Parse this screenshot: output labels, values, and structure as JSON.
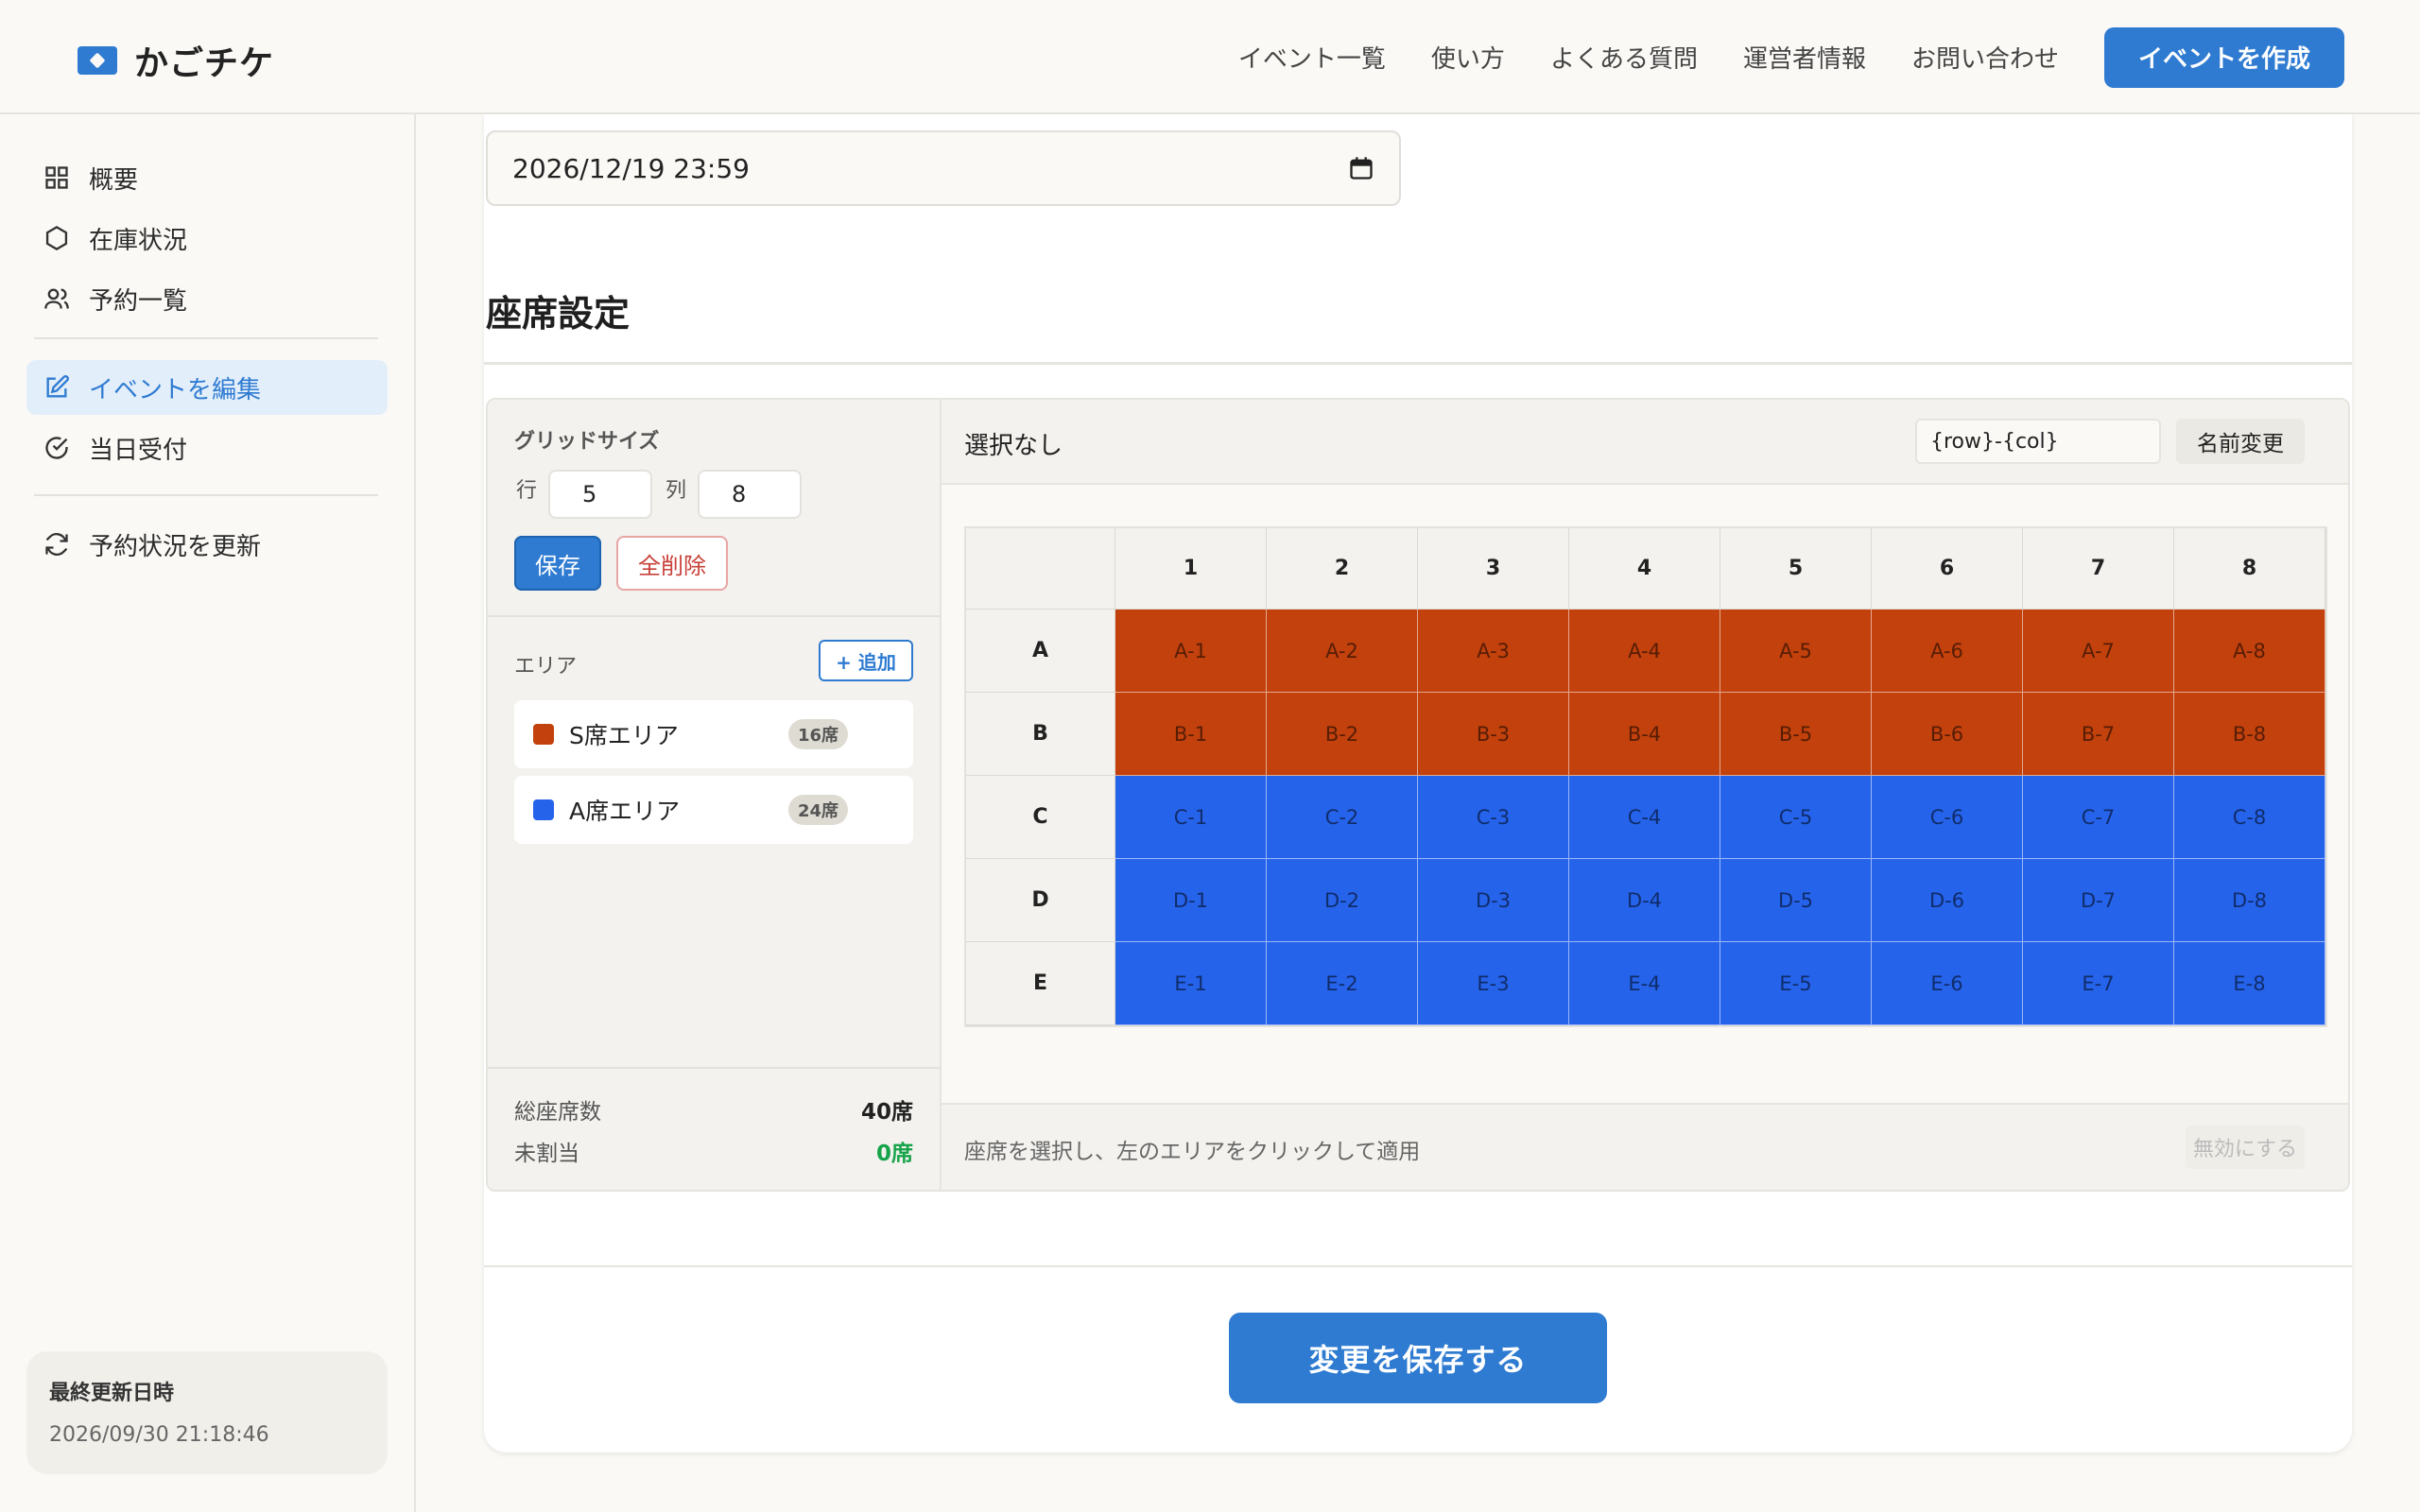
{
  "header": {
    "logo_text": "かごチケ",
    "nav": [
      "イベント一覧",
      "使い方",
      "よくある質問",
      "運営者情報",
      "お問い合わせ"
    ],
    "cta": "イベントを作成",
    "brand_color": "#2e7bd1"
  },
  "sidebar": {
    "items": [
      {
        "label": "概要",
        "icon": "grid-icon"
      },
      {
        "label": "在庫状況",
        "icon": "hexagon-icon"
      },
      {
        "label": "予約一覧",
        "icon": "users-icon"
      },
      {
        "label": "イベントを編集",
        "icon": "edit-icon",
        "active": true
      },
      {
        "label": "当日受付",
        "icon": "check-circle-icon"
      },
      {
        "label": "予約状況を更新",
        "icon": "refresh-icon"
      }
    ],
    "update_title": "最終更新日時",
    "update_time": "2026/09/30 21:18:46"
  },
  "form": {
    "deadline_value": "2026/12/19  23:59",
    "section_title": "座席設定"
  },
  "editor": {
    "grid_size_label": "グリッドサイズ",
    "rows_label": "行",
    "rows_value": "5",
    "cols_label": "列",
    "cols_value": "8",
    "save_label": "保存",
    "clear_label": "全削除",
    "area_label": "エリア",
    "add_label": "+ 追加",
    "areas": [
      {
        "name": "S席エリア",
        "count": "16席",
        "color": "#c2410c"
      },
      {
        "name": "A席エリア",
        "count": "24席",
        "color": "#2563eb"
      }
    ],
    "total_label": "総座席数",
    "total_value": "40席",
    "unassigned_label": "未割当",
    "unassigned_value": "0席",
    "selection_text": "選択なし",
    "pattern_value": "{row}-{col}",
    "rename_label": "名前変更",
    "hint_text": "座席を選択し、左のエリアをクリックして適用",
    "disable_label": "無効にする",
    "column_headers": [
      "1",
      "2",
      "3",
      "4",
      "5",
      "6",
      "7",
      "8"
    ],
    "row_headers": [
      "A",
      "B",
      "C",
      "D",
      "E"
    ],
    "row_areas": [
      0,
      0,
      1,
      1,
      1
    ]
  },
  "footer": {
    "save_changes_label": "変更を保存する"
  }
}
